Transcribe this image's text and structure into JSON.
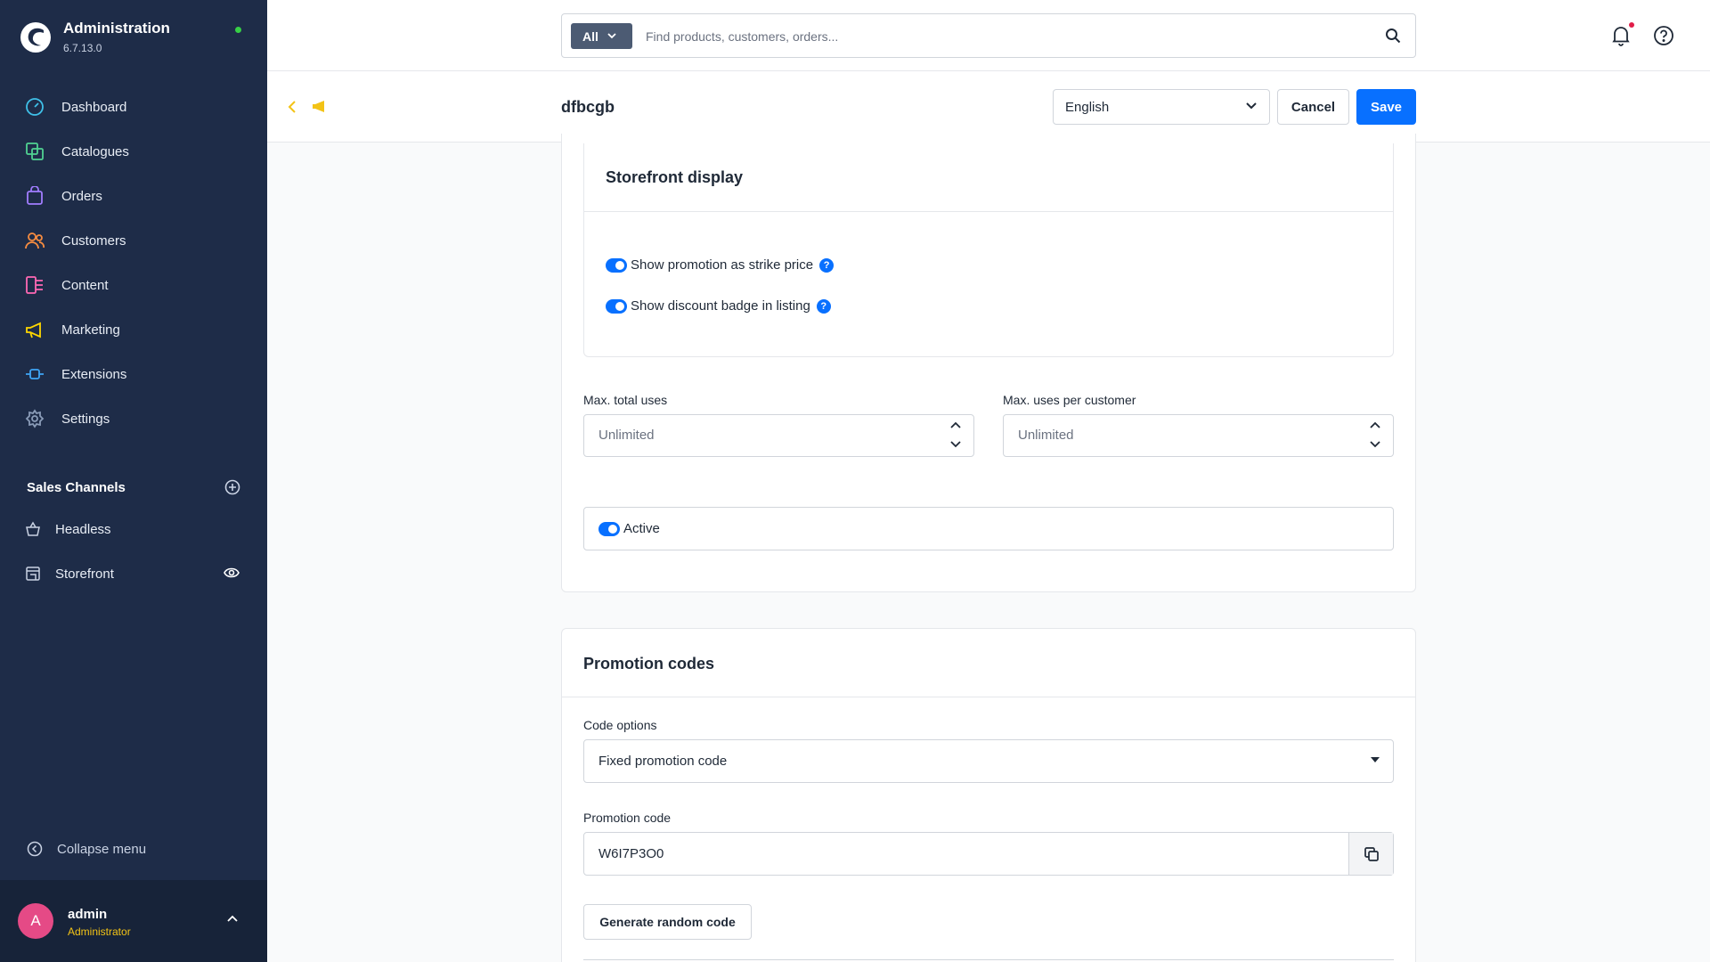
{
  "app": {
    "title": "Administration",
    "version": "6.7.13.0"
  },
  "sidebar": {
    "items": [
      {
        "label": "Dashboard",
        "icon": "dashboard-icon",
        "color": "#3fc0e8"
      },
      {
        "label": "Catalogues",
        "icon": "catalogues-icon",
        "color": "#50d292"
      },
      {
        "label": "Orders",
        "icon": "orders-icon",
        "color": "#a17dff"
      },
      {
        "label": "Customers",
        "icon": "customers-icon",
        "color": "#f78c40"
      },
      {
        "label": "Content",
        "icon": "content-icon",
        "color": "#ff68b4"
      },
      {
        "label": "Marketing",
        "icon": "marketing-icon",
        "color": "#ffd700"
      },
      {
        "label": "Extensions",
        "icon": "extensions-icon",
        "color": "#3fa5f5"
      },
      {
        "label": "Settings",
        "icon": "settings-icon",
        "color": "#8a9cb8"
      }
    ],
    "sales_channels_title": "Sales Channels",
    "sales_channels": [
      {
        "label": "Headless",
        "icon": "basket-icon"
      },
      {
        "label": "Storefront",
        "icon": "storefront-icon"
      }
    ],
    "collapse_label": "Collapse menu"
  },
  "user": {
    "initial": "A",
    "name": "admin",
    "role": "Administrator"
  },
  "topbar": {
    "search_type": "All",
    "search_placeholder": "Find products, customers, orders..."
  },
  "smartbar": {
    "title": "dfbcgb",
    "language": "English",
    "cancel_label": "Cancel",
    "save_label": "Save"
  },
  "storefront": {
    "title": "Storefront display",
    "toggles": [
      {
        "label": "Show promotion as strike price",
        "on": true
      },
      {
        "label": "Show discount badge in listing",
        "on": true
      }
    ]
  },
  "limits": {
    "max_total_label": "Max. total uses",
    "max_total_placeholder": "Unlimited",
    "max_customer_label": "Max. uses per customer",
    "max_customer_placeholder": "Unlimited"
  },
  "active": {
    "label": "Active",
    "on": true
  },
  "codes": {
    "title": "Promotion codes",
    "code_options_label": "Code options",
    "code_options_value": "Fixed promotion code",
    "promotion_code_label": "Promotion code",
    "promotion_code_value": "W6I7P3O0",
    "generate_label": "Generate random code"
  },
  "colors": {
    "accent": "#0870ff",
    "sidebar": "#1e2c48"
  }
}
